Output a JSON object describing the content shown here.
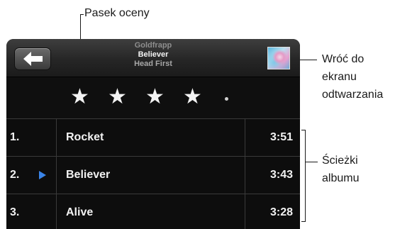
{
  "callouts": {
    "rating_bar": "Pasek oceny",
    "back_to_now_playing": [
      "Wróć do",
      "ekranu",
      "odtwarzania"
    ],
    "album_tracks": [
      "Ścieżki",
      "albumu"
    ]
  },
  "header": {
    "artist": "Goldfrapp",
    "song": "Believer",
    "album": "Head First",
    "back_icon": "back-arrow-icon",
    "album_art_icon": "album-art-thumbnail"
  },
  "rating": {
    "stars": 4,
    "max_stars": 5
  },
  "tracks": [
    {
      "number": "1.",
      "title": "Rocket",
      "duration": "3:51",
      "playing": false
    },
    {
      "number": "2.",
      "title": "Believer",
      "duration": "3:43",
      "playing": true
    },
    {
      "number": "3.",
      "title": "Alive",
      "duration": "3:28",
      "playing": false
    }
  ],
  "colors": {
    "screen_bg": "#0d0d0d",
    "text": "#f2f2f2",
    "play_indicator": "#3a84e8"
  }
}
